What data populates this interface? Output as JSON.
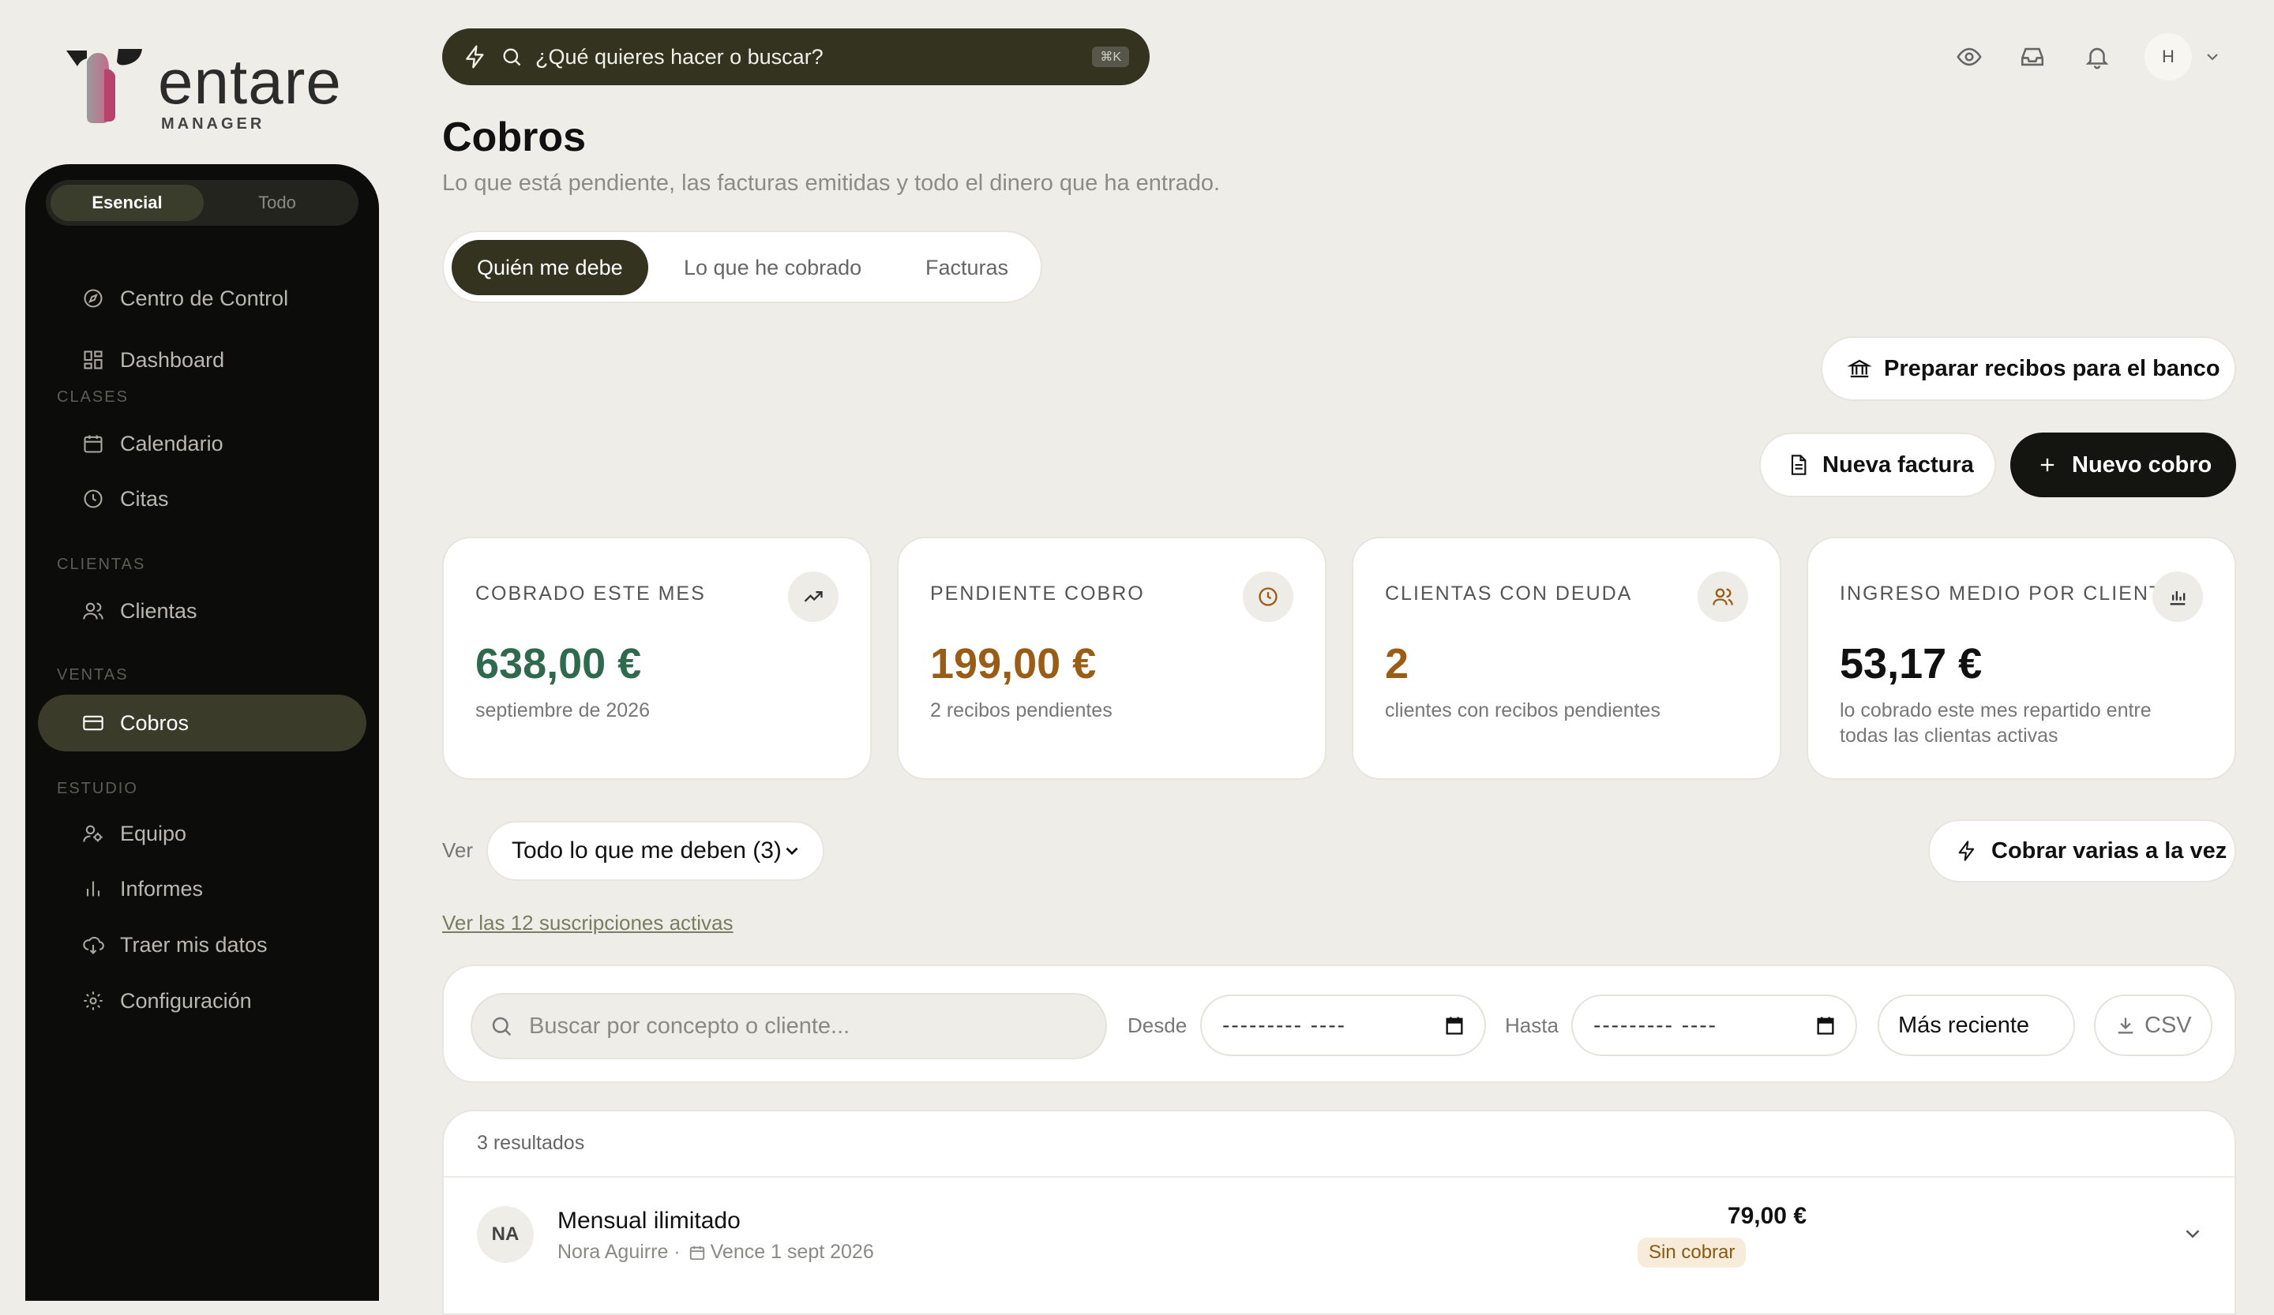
{
  "brand": {
    "name": "entare",
    "subtitle": "MANAGER"
  },
  "sidebar": {
    "mode_toggle": {
      "active": "Esencial",
      "other": "Todo"
    },
    "items_top": [
      {
        "label": "Centro de Control",
        "icon": "compass-icon"
      },
      {
        "label": "Dashboard",
        "icon": "grid-icon"
      }
    ],
    "sections": {
      "clases": "CLASES",
      "clientas": "CLIENTAS",
      "ventas": "VENTAS",
      "estudio": "ESTUDIO"
    },
    "clases_items": [
      {
        "label": "Calendario",
        "icon": "calendar-icon"
      },
      {
        "label": "Citas",
        "icon": "clock-icon"
      }
    ],
    "clientas_items": [
      {
        "label": "Clientas",
        "icon": "users-icon"
      }
    ],
    "ventas_items": [
      {
        "label": "Cobros",
        "icon": "credit-card-icon",
        "active": true
      }
    ],
    "estudio_items": [
      {
        "label": "Equipo",
        "icon": "team-icon"
      },
      {
        "label": "Informes",
        "icon": "bar-chart-icon"
      },
      {
        "label": "Traer mis datos",
        "icon": "cloud-download-icon"
      },
      {
        "label": "Configuración",
        "icon": "gear-icon"
      }
    ]
  },
  "topbar": {
    "command_placeholder": "¿Qué quieres hacer o buscar?",
    "shortcut": "⌘K",
    "avatar_initial": "H"
  },
  "header": {
    "title": "Cobros",
    "subtitle": "Lo que está pendiente, las facturas emitidas y todo el dinero que ha entrado."
  },
  "tabs": [
    {
      "label": "Quién me debe",
      "active": true
    },
    {
      "label": "Lo que he cobrado",
      "active": false
    },
    {
      "label": "Facturas",
      "active": false
    }
  ],
  "actions": {
    "bank": "Preparar recibos para el banco",
    "new_invoice": "Nueva factura",
    "new_payment": "Nuevo cobro",
    "bulk_collect": "Cobrar varias a la vez"
  },
  "stats": [
    {
      "title": "COBRADO ESTE MES",
      "value": "638,00 €",
      "note": "septiembre de 2026",
      "color": "#2f6a4f",
      "icon": "trending-up-icon"
    },
    {
      "title": "PENDIENTE COBRO",
      "value": "199,00 €",
      "note": "2 recibos pendientes",
      "color": "#9a5d17",
      "icon": "clock-icon"
    },
    {
      "title": "CLIENTAS CON DEUDA",
      "value": "2",
      "note": "clientes con recibos pendientes",
      "color": "#9a5d17",
      "icon": "users-icon"
    },
    {
      "title": "INGRESO MEDIO POR CLIENTA",
      "value": "53,17 €",
      "note": "lo cobrado este mes repartido entre todas las clientas activas",
      "color": "#111111",
      "icon": "bar-chart-icon"
    }
  ],
  "filters": {
    "ver_label": "Ver",
    "ver_value": "Todo lo que me deben (3)",
    "subscriptions_link": "Ver las 12 suscripciones activas",
    "search_placeholder": "Buscar por concepto o cliente...",
    "desde_label": "Desde",
    "hasta_label": "Hasta",
    "date_placeholder": "--------- ----",
    "sort_value": "Más reciente",
    "export_label": "CSV"
  },
  "results": {
    "count_text": "3 resultados",
    "rows": [
      {
        "initials": "NA",
        "title": "Mensual ilimitado",
        "client": "Nora Aguirre ·",
        "due": "Vence 1 sept 2026",
        "amount": "79,00 €",
        "status": "Sin cobrar"
      }
    ]
  }
}
